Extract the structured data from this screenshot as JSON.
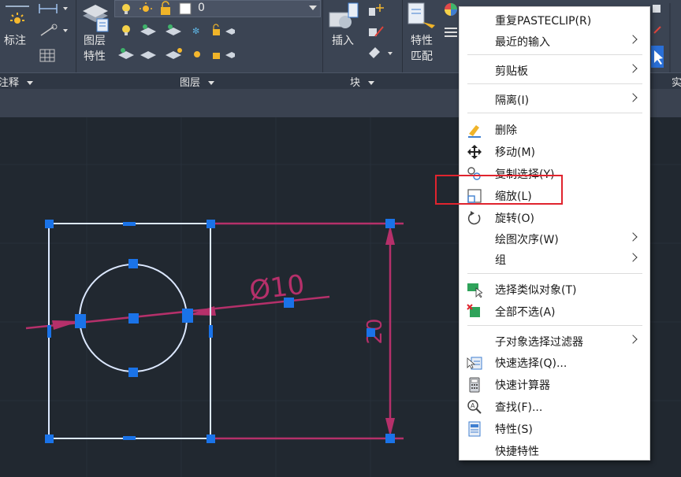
{
  "ribbon": {
    "annotate_label": "标注",
    "layer_props_label": [
      "图层",
      "特性"
    ],
    "layer_combo_value": "0",
    "insert_label": "插入",
    "match_props_label": [
      "特性",
      "匹配"
    ],
    "panel_titles": {
      "annotate": "注释",
      "layers": "图层",
      "block": "块",
      "right": "实"
    }
  },
  "context_menu": {
    "items": [
      {
        "label": "重复PASTECLIP(R)",
        "submenu": false,
        "icon": ""
      },
      {
        "label": "最近的输入",
        "submenu": true,
        "icon": ""
      },
      {
        "label": "剪贴板",
        "submenu": true,
        "icon": ""
      },
      {
        "label": "隔离(I)",
        "submenu": true,
        "icon": ""
      },
      {
        "label": "删除",
        "submenu": false,
        "icon": "eraser-icon"
      },
      {
        "label": "移动(M)",
        "submenu": false,
        "icon": "move-icon"
      },
      {
        "label": "复制选择(Y)",
        "submenu": false,
        "icon": "copy-icon"
      },
      {
        "label": "缩放(L)",
        "submenu": false,
        "icon": "scale-icon"
      },
      {
        "label": "旋转(O)",
        "submenu": false,
        "icon": "rotate-icon"
      },
      {
        "label": "绘图次序(W)",
        "submenu": true,
        "icon": ""
      },
      {
        "label": "组",
        "submenu": true,
        "icon": ""
      },
      {
        "label": "选择类似对象(T)",
        "submenu": false,
        "icon": "select-similar-icon"
      },
      {
        "label": "全部不选(A)",
        "submenu": false,
        "icon": "deselect-all-icon"
      },
      {
        "label": "子对象选择过滤器",
        "submenu": true,
        "icon": ""
      },
      {
        "label": "快速选择(Q)...",
        "submenu": false,
        "icon": "quick-select-icon"
      },
      {
        "label": "快速计算器",
        "submenu": false,
        "icon": "calculator-icon"
      },
      {
        "label": "查找(F)...",
        "submenu": false,
        "icon": "find-icon"
      },
      {
        "label": "特性(S)",
        "submenu": false,
        "icon": "properties-icon"
      },
      {
        "label": "快捷特性",
        "submenu": false,
        "icon": ""
      }
    ],
    "highlighted_item": "缩放(L)"
  },
  "drawing": {
    "diameter_dim": "Ø10",
    "height_dim": "20"
  },
  "colors": {
    "dimension": "#b5306a",
    "geometry": "#dce8ff",
    "grip": "#1a73e8",
    "highlight_box": "#e0242e"
  }
}
